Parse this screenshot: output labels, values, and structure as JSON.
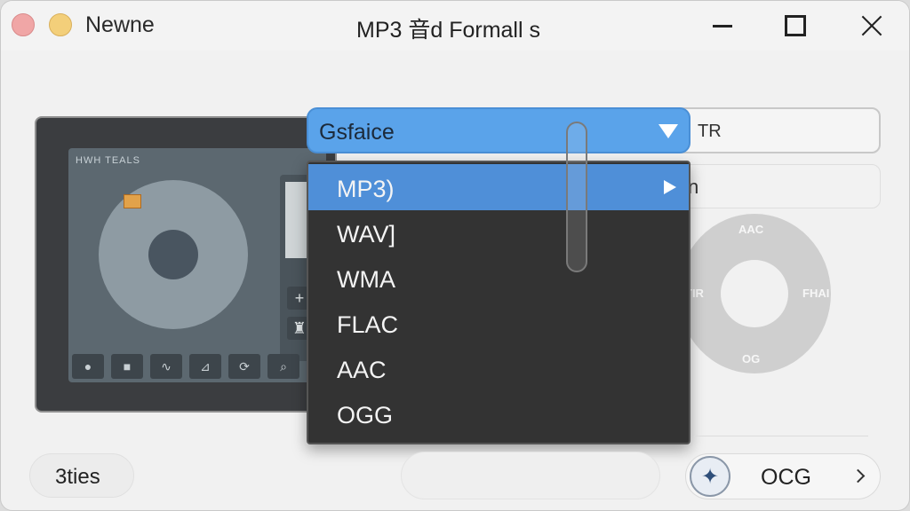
{
  "window": {
    "app_name": "Newne",
    "title": "MP3 音d Formall s"
  },
  "device": {
    "label": "HWH TEALS",
    "side_buttons": [
      "+",
      "♜"
    ],
    "tools": [
      "●",
      "■",
      "∿",
      "⊿",
      "⟳",
      "⌕"
    ]
  },
  "format_select": {
    "value": "Gsfaice",
    "options": [
      "MP3)",
      "WAV]",
      "WMA",
      "FLAC",
      "AAC",
      "OGG"
    ],
    "selected_index": 0
  },
  "side_fields": {
    "top_value": "TR",
    "second_value": "n"
  },
  "format_wheel": {
    "top": "AAC",
    "bottom": "OG",
    "left": "TIR",
    "right": "FHAI"
  },
  "bottom_bar": {
    "left_button": "3ties",
    "right_button": "OCG",
    "right_icon": "✦"
  },
  "colors": {
    "accent": "#5aa3ea",
    "menu_bg": "#333333",
    "menu_selected": "#4f8fd8"
  }
}
